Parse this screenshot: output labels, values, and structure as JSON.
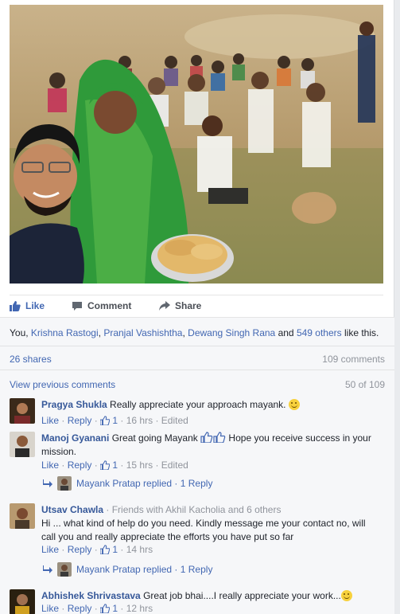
{
  "post": {
    "photo_icon": "photo-of-villagers-selfie"
  },
  "actions": {
    "like_label": "Like",
    "comment_label": "Comment",
    "share_label": "Share",
    "like_color": "#4267b2"
  },
  "likes": {
    "prefix": "You, ",
    "name1": "Krishna Rastogi",
    "sep1": ", ",
    "name2": "Pranjal Vashishtha",
    "sep2": ", ",
    "name3": "Dewang Singh Rana",
    "sep3": " and ",
    "others": "549 others",
    "suffix": " like this."
  },
  "shares": {
    "shares_label": "26 shares",
    "comments_label": "109 comments"
  },
  "previous": {
    "link_label": "View previous comments",
    "count_label": "50 of 109"
  },
  "comments": [
    {
      "author": "Pragya Shukla",
      "text": " Really appreciate your approach mayank. ",
      "like": "Like",
      "reply": "Reply",
      "likes_count": "1",
      "time": "16 hrs",
      "edited": "Edited"
    },
    {
      "author": "Manoj Gyanani",
      "text_a": " Great going Mayank ",
      "text_b": " Hope you receive success in your mission.",
      "like": "Like",
      "reply": "Reply",
      "likes_count": "1",
      "time": "15 hrs",
      "edited": "Edited",
      "reply_line": {
        "name": "Mayank Pratap",
        "replied": " replied · ",
        "count": "1 Reply"
      }
    },
    {
      "author": "Utsav Chawla",
      "friends": " · Friends with Akhil Kacholia and 6 others",
      "text": "Hi ... what kind of help do you need. Kindly message me your contact no, will call you and really appreciate the efforts you have put so far",
      "like": "Like",
      "reply": "Reply",
      "likes_count": "1",
      "time": "14 hrs",
      "reply_line": {
        "name": "Mayank Pratap",
        "replied": " replied · ",
        "count": "1 Reply"
      }
    },
    {
      "author": "Abhishek Shrivastava",
      "text": " Great job bhai....I really appreciate your work...",
      "like": "Like",
      "reply": "Reply",
      "likes_count": "1",
      "time": "12 hrs"
    }
  ]
}
